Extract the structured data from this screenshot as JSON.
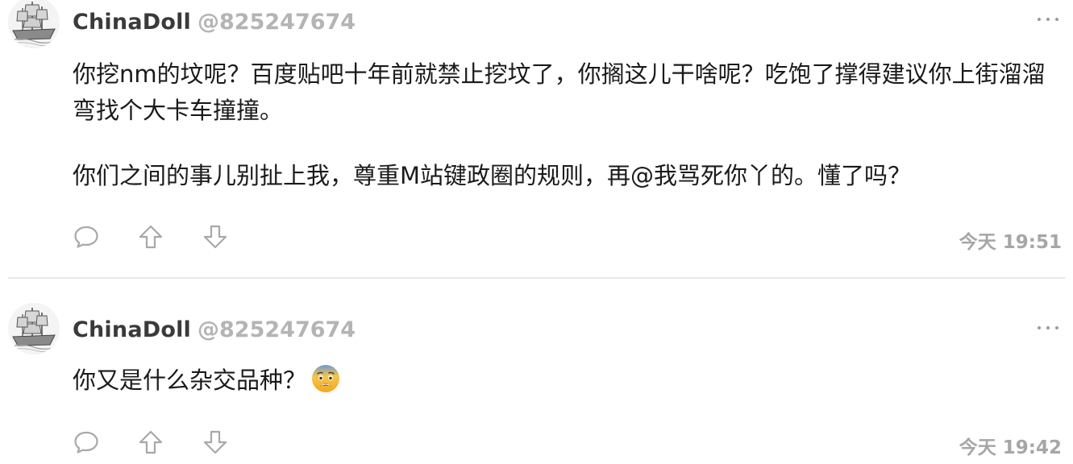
{
  "comments": [
    {
      "username": "ChinaDoll",
      "handle": "@825247674",
      "paragraphs": [
        "你挖nm的坟呢？百度贴吧十年前就禁止挖坟了，你搁这儿干啥呢？吃饱了撑得建议你上街溜溜弯找个大卡车撞撞。",
        "你们之间的事儿别扯上我，尊重M站键政圈的规则，再@我骂死你丫的。懂了吗？"
      ],
      "timestamp": "今天 19:51"
    },
    {
      "username": "ChinaDoll",
      "handle": "@825247674",
      "paragraphs": [
        "你又是什么杂交品种？"
      ],
      "emoji": "fearful-face",
      "timestamp": "今天 19:42"
    }
  ],
  "icons": {
    "reply": "speech-bubble-icon",
    "upvote": "arrow-up-icon",
    "downvote": "arrow-down-icon",
    "more": "more-dots-icon"
  },
  "colors": {
    "username": "#3a3a3a",
    "handle": "#b4b4b4",
    "icon": "#a8a8a8",
    "divider": "#e8e8e8"
  }
}
